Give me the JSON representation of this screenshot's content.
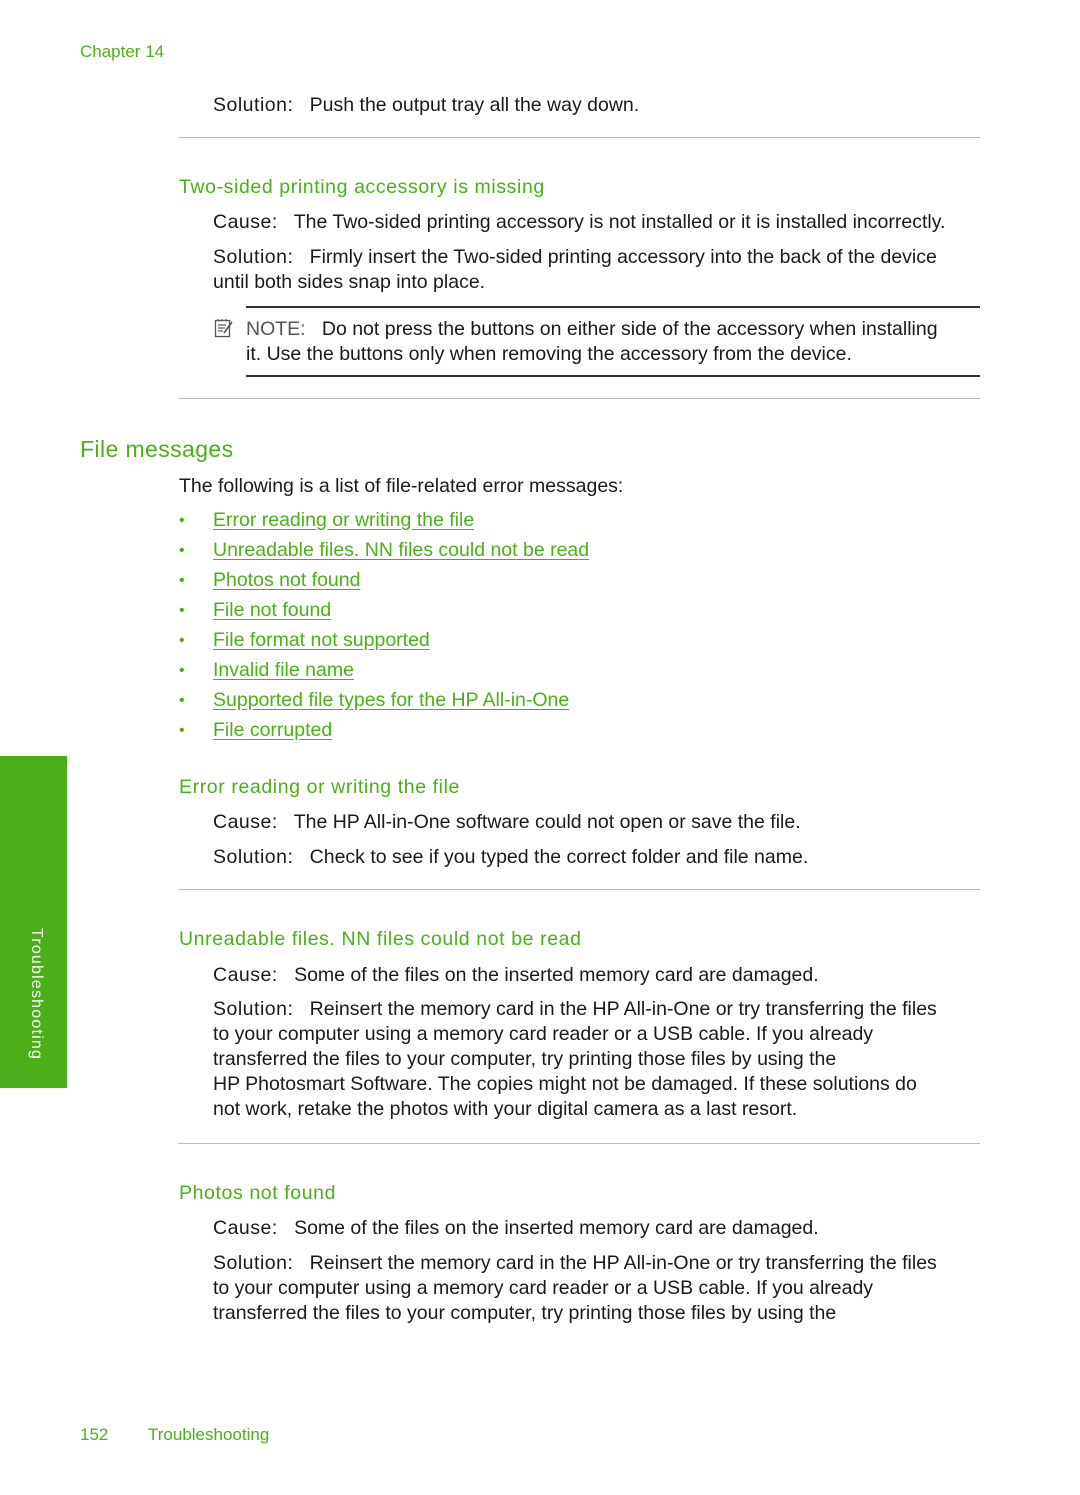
{
  "header": {
    "chapter": "Chapter 14"
  },
  "top_solution": {
    "label": "Solution:",
    "text": "Push the output tray all the way down."
  },
  "two_sided": {
    "heading": "Two-sided printing accessory is missing",
    "cause_label": "Cause:",
    "cause_text": "The Two-sided printing accessory is not installed or it is installed incorrectly.",
    "solution_label": "Solution:",
    "solution_line1": "Firmly insert the Two-sided printing accessory into the back of the device",
    "solution_line2": "until both sides snap into place.",
    "note_label": "NOTE:",
    "note_line1": "Do not press the buttons on either side of the accessory when installing",
    "note_line2": "it. Use the buttons only when removing the accessory from the device."
  },
  "file_messages": {
    "heading": "File messages",
    "intro": "The following is a list of file-related error messages:",
    "links": [
      "Error reading or writing the file",
      "Unreadable files. NN files could not be read",
      "Photos not found",
      "File not found",
      "File format not supported",
      "Invalid file name",
      "Supported file types for the HP All-in-One",
      "File corrupted"
    ]
  },
  "error_rw": {
    "heading": "Error reading or writing the file",
    "cause_label": "Cause:",
    "cause_text": "The HP All-in-One software could not open or save the file.",
    "solution_label": "Solution:",
    "solution_text": "Check to see if you typed the correct folder and file name."
  },
  "unreadable": {
    "heading": "Unreadable files. NN files could not be read",
    "cause_label": "Cause:",
    "cause_text": "Some of the files on the inserted memory card are damaged.",
    "solution_label": "Solution:",
    "solution_lines": [
      "Reinsert the memory card in the HP All-in-One or try transferring the files",
      "to your computer using a memory card reader or a USB cable. If you already",
      "transferred the files to your computer, try printing those files by using the",
      "HP Photosmart Software. The copies might not be damaged. If these solutions do",
      "not work, retake the photos with your digital camera as a last resort."
    ]
  },
  "photos_not_found": {
    "heading": "Photos not found",
    "cause_label": "Cause:",
    "cause_text": "Some of the files on the inserted memory card are damaged.",
    "solution_label": "Solution:",
    "solution_lines": [
      "Reinsert the memory card in the HP All-in-One or try transferring the files",
      "to your computer using a memory card reader or a USB cable. If you already",
      "transferred the files to your computer, try printing those files by using the"
    ]
  },
  "side_tab": {
    "label": "Troubleshooting"
  },
  "footer": {
    "page_number": "152",
    "section": "Troubleshooting"
  },
  "colors": {
    "accent": "#4caf1a",
    "text": "#1a1a1a",
    "rule": "#bdbdbd"
  }
}
